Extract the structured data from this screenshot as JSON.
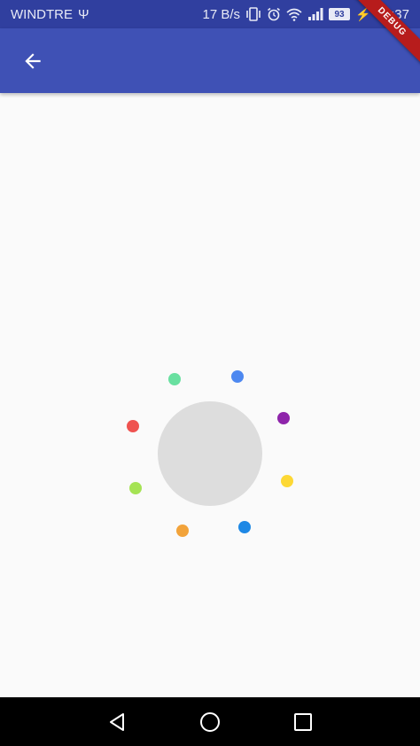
{
  "status_bar": {
    "carrier": "WINDTRE",
    "net_speed": "17 B/s",
    "battery": "93",
    "time": "12:37"
  },
  "debug_banner": "DEBUG",
  "colors": {
    "status_bar": "#303f9f",
    "app_bar": "#3f51b5",
    "circle": "#dddddd",
    "dots": [
      "#4d88f0",
      "#8e24aa",
      "#fdd835",
      "#1e88e5",
      "#f2a33a",
      "#a5e354",
      "#ef5350",
      "#69e0a0"
    ]
  },
  "icons": {
    "back": "arrow-left-icon",
    "nav": [
      "back-triangle-icon",
      "home-circle-icon",
      "recents-square-icon"
    ]
  }
}
